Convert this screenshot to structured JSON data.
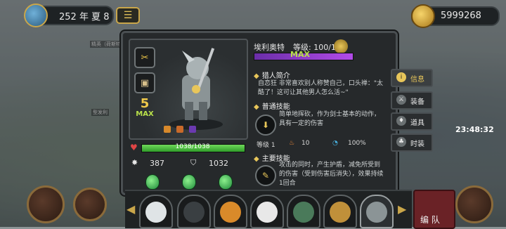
{
  "hud": {
    "date": "252 年 夏 8",
    "menu_icon": "menu-icon",
    "gold": "5999268"
  },
  "map_labels": [
    "精英（荷斯特）",
    "型发利"
  ],
  "hero": {
    "name": "埃利奥特",
    "level_text": "等级: 100/100",
    "star_level": "5",
    "max_label": "MAX",
    "xp_max_label": "MAX",
    "hp_text": "1038/1038",
    "hp_fraction": 1.0,
    "attack": "387",
    "defense": "1032",
    "intro_title": "猎人简介",
    "intro_text": "自恋狂 非常喜欢别人称赞自己，口头禅：\"太酷了！这可让其他男人怎么活~\"",
    "normal_skill_title": "普通技能",
    "normal_skill_desc": "简单地挥砍，作为剑士基本的动作，具有一定的伤害",
    "skill_level_label": "等级 1",
    "skill_cost": "10",
    "skill_rate": "100%",
    "main_skill_title": "主要技能",
    "main_skill_desc": "攻击的同时，产生护盾，减免所受到的伤害（受到伤害后消失），效果持续1回合"
  },
  "tabs": [
    {
      "label": "信息",
      "icon": "info-icon",
      "active": true
    },
    {
      "label": "装备",
      "icon": "equip-icon",
      "active": false
    },
    {
      "label": "道具",
      "icon": "potion-icon",
      "active": false
    },
    {
      "label": "时装",
      "icon": "shirt-icon",
      "active": false
    }
  ],
  "timer": "23:48:32",
  "formation_label": "编 队",
  "roster": [
    "hero-portrait-1",
    "hero-portrait-2",
    "hero-portrait-3",
    "hero-portrait-4",
    "hero-portrait-5",
    "hero-portrait-6",
    "hero-portrait-7"
  ],
  "colors": {
    "accent": "#e8c65a",
    "hp": "#2f9c2a",
    "xp": "#b24be8",
    "max": "#b8e04a"
  }
}
